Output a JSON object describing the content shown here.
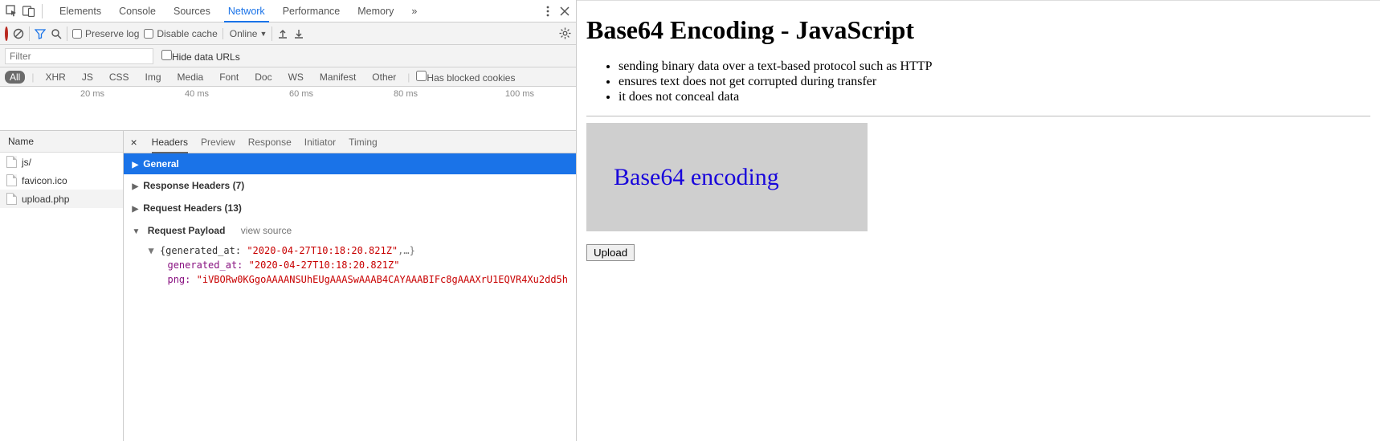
{
  "devtools": {
    "tabs": [
      "Elements",
      "Console",
      "Sources",
      "Network",
      "Performance",
      "Memory"
    ],
    "active_tab": "Network",
    "preserve_log_label": "Preserve log",
    "disable_cache_label": "Disable cache",
    "throttle": "Online",
    "filter_placeholder": "Filter",
    "hide_data_urls_label": "Hide data URLs",
    "req_types": [
      "All",
      "XHR",
      "JS",
      "CSS",
      "Img",
      "Media",
      "Font",
      "Doc",
      "WS",
      "Manifest",
      "Other"
    ],
    "has_blocked_cookies_label": "Has blocked cookies",
    "timeline_ticks": [
      "20 ms",
      "40 ms",
      "60 ms",
      "80 ms",
      "100 ms"
    ],
    "list_header": "Name",
    "requests": [
      {
        "name": "js/"
      },
      {
        "name": "favicon.ico"
      },
      {
        "name": "upload.php"
      }
    ],
    "selected_request_index": 2,
    "detail_tabs": [
      "Headers",
      "Preview",
      "Response",
      "Initiator",
      "Timing"
    ],
    "detail_tab_active": "Headers",
    "sections": {
      "general": "General",
      "response_headers": "Response Headers (7)",
      "request_headers": "Request Headers (13)",
      "request_payload": "Request Payload",
      "view_source": "view source"
    },
    "payload": {
      "summary_prefix": "{generated_at: ",
      "summary_value": "\"2020-04-27T10:18:20.821Z\"",
      "summary_suffix": ",…}",
      "generated_at_key": "generated_at:",
      "generated_at_val": "\"2020-04-27T10:18:20.821Z\"",
      "png_key": "png:",
      "png_val": "\"iVBORw0KGgoAAAANSUhEUgAAASwAAAB4CAYAAABIFc8gAAAXrU1EQVR4Xu2dd5h"
    }
  },
  "page": {
    "heading": "Base64 Encoding - JavaScript",
    "bullets": [
      "sending binary data over a text-based protocol such as HTTP",
      "ensures text does not get corrupted during transfer",
      "it does not conceal data"
    ],
    "image_text": "Base64 encoding",
    "upload_label": "Upload"
  }
}
